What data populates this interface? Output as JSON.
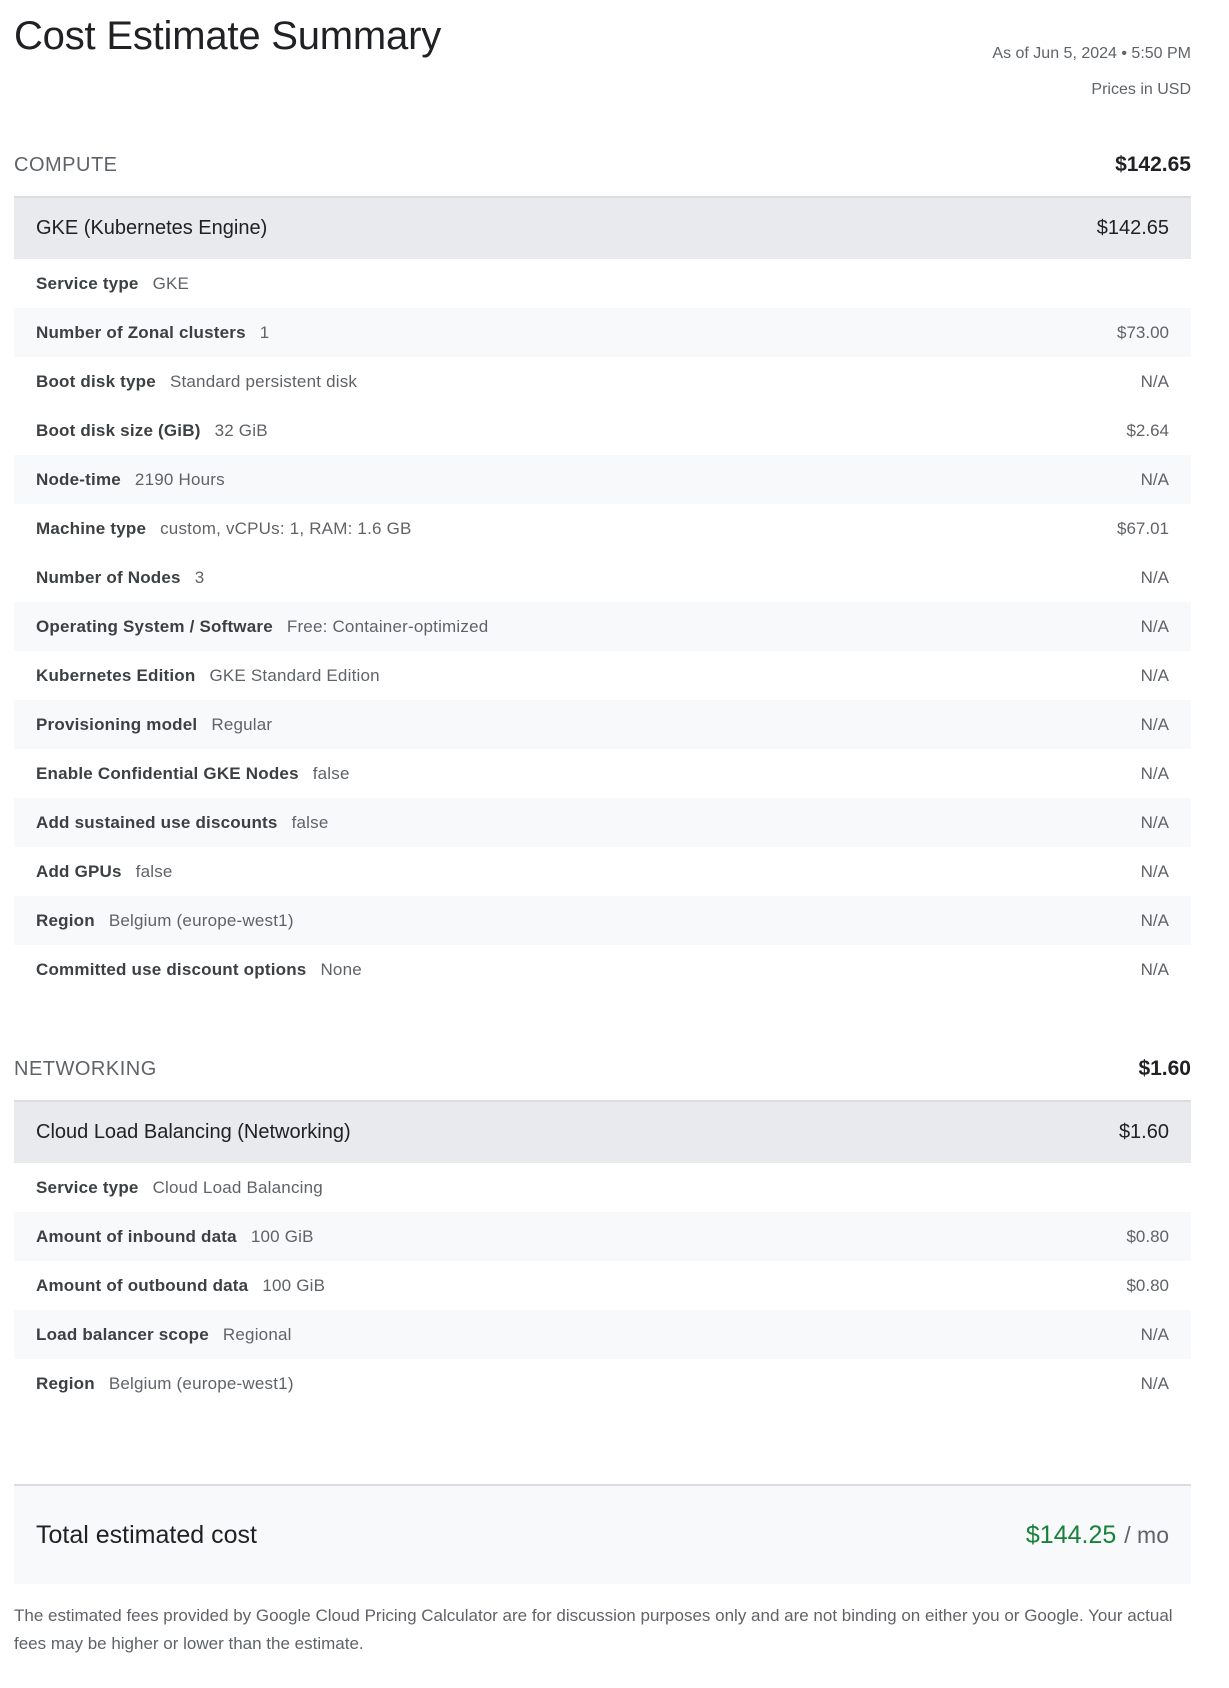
{
  "header": {
    "title": "Cost Estimate Summary",
    "as_of": "As of Jun 5, 2024 • 5:50 PM",
    "currency_note": "Prices in USD"
  },
  "sections": [
    {
      "name": "COMPUTE",
      "total": "$142.65",
      "service": {
        "name": "GKE (Kubernetes Engine)",
        "cost": "$142.65",
        "rows": [
          {
            "label": "Service type",
            "value": "GKE",
            "cost": ""
          },
          {
            "label": "Number of Zonal clusters",
            "value": "1",
            "cost": "$73.00"
          },
          {
            "label": "Boot disk type",
            "value": "Standard persistent disk",
            "cost": "N/A"
          },
          {
            "label": "Boot disk size (GiB)",
            "value": "32 GiB",
            "cost": "$2.64"
          },
          {
            "label": "Node-time",
            "value": "2190 Hours",
            "cost": "N/A"
          },
          {
            "label": "Machine type",
            "value": "custom, vCPUs: 1, RAM: 1.6 GB",
            "cost": "$67.01"
          },
          {
            "label": "Number of Nodes",
            "value": "3",
            "cost": "N/A"
          },
          {
            "label": "Operating System / Software",
            "value": "Free: Container-optimized",
            "cost": "N/A"
          },
          {
            "label": "Kubernetes Edition",
            "value": "GKE Standard Edition",
            "cost": "N/A"
          },
          {
            "label": "Provisioning model",
            "value": "Regular",
            "cost": "N/A"
          },
          {
            "label": "Enable Confidential GKE Nodes",
            "value": "false",
            "cost": "N/A"
          },
          {
            "label": "Add sustained use discounts",
            "value": "false",
            "cost": "N/A"
          },
          {
            "label": "Add GPUs",
            "value": "false",
            "cost": "N/A"
          },
          {
            "label": "Region",
            "value": "Belgium (europe-west1)",
            "cost": "N/A"
          },
          {
            "label": "Committed use discount options",
            "value": "None",
            "cost": "N/A"
          }
        ]
      }
    },
    {
      "name": "NETWORKING",
      "total": "$1.60",
      "service": {
        "name": "Cloud Load Balancing (Networking)",
        "cost": "$1.60",
        "rows": [
          {
            "label": "Service type",
            "value": "Cloud Load Balancing",
            "cost": ""
          },
          {
            "label": "Amount of inbound data",
            "value": "100 GiB",
            "cost": "$0.80"
          },
          {
            "label": "Amount of outbound data",
            "value": "100 GiB",
            "cost": "$0.80"
          },
          {
            "label": "Load balancer scope",
            "value": "Regional",
            "cost": "N/A"
          },
          {
            "label": "Region",
            "value": "Belgium (europe-west1)",
            "cost": "N/A"
          }
        ]
      }
    }
  ],
  "total": {
    "label": "Total estimated cost",
    "amount": "$144.25",
    "unit": "/ mo",
    "amount_color": "#188038"
  },
  "disclaimer": "The estimated fees provided by Google Cloud Pricing Calculator are for discussion purposes only and are not binding on either you or Google. Your actual fees may be higher or lower than the estimate."
}
